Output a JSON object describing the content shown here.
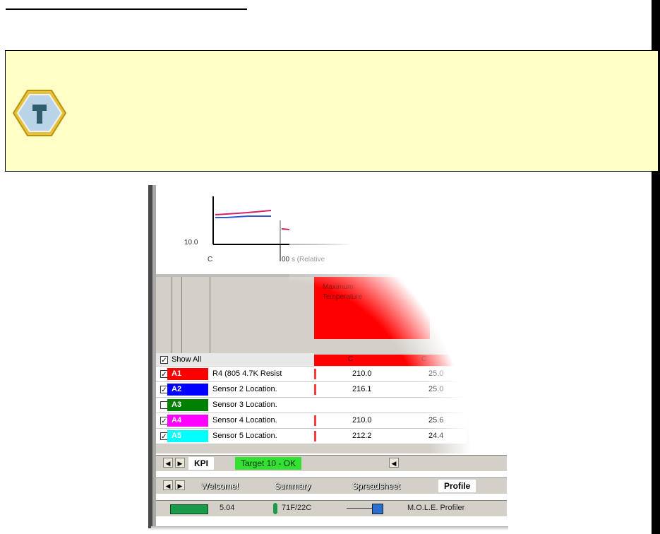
{
  "tip": {
    "icon": "tip-icon"
  },
  "chart": {
    "ytick": "10.0",
    "xtick_start": "C",
    "xtick_mid": "00 s (Relative"
  },
  "grid": {
    "column_header": "Maximum Temperature",
    "unit1": "C",
    "unit2": "C",
    "show_all": "Show All",
    "rows": [
      {
        "badge": "A1",
        "color": "#ff0000",
        "label": "R4 (805 4.7K Resist",
        "v1": "210.0",
        "v2": "25.0",
        "checked": true
      },
      {
        "badge": "A2",
        "color": "#0000ff",
        "label": "Sensor 2 Location.",
        "v1": "216.1",
        "v2": "25.0",
        "checked": true
      },
      {
        "badge": "A3",
        "color": "#008000",
        "label": "Sensor 3 Location.",
        "v1": "",
        "v2": "",
        "checked": false
      },
      {
        "badge": "A4",
        "color": "#ff00ff",
        "label": "Sensor 4 Location.",
        "v1": "210.0",
        "v2": "25.6",
        "checked": true
      },
      {
        "badge": "A5",
        "color": "#00ffff",
        "label": "Sensor 5 Location.",
        "v1": "212.2",
        "v2": "24.4",
        "checked": true
      }
    ]
  },
  "tabs_top": {
    "tab1": "KPI",
    "tab2": "Target 10 - OK"
  },
  "tabs_bottom": {
    "tab1": "Welcome!",
    "tab2": "Summary",
    "tab3": "Spreadsheet",
    "tab4": "Profile"
  },
  "status": {
    "battery": "5.04",
    "temp": "71F/22C",
    "device": "M.O.L.E. Profiler"
  }
}
